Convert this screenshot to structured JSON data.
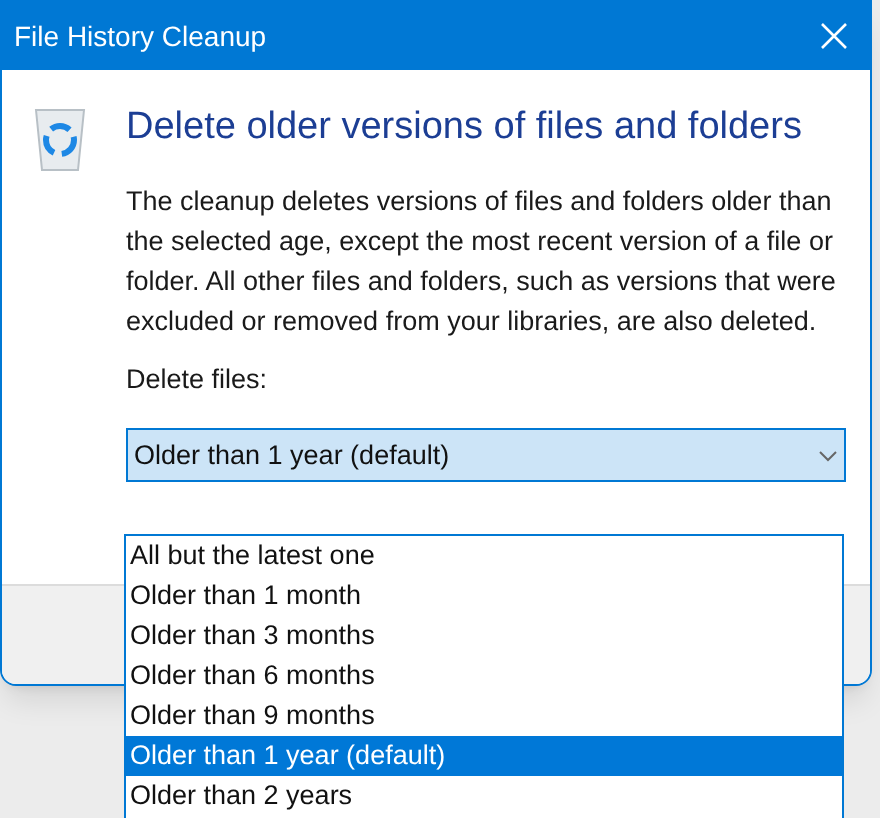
{
  "window": {
    "title": "File History Cleanup"
  },
  "heading": "Delete older versions of files and folders",
  "description": "The cleanup deletes versions of files and folders older than the selected age, except the most recent version of a file or folder. All other files and folders, such as versions that were excluded or removed from your libraries, are also deleted.",
  "delete_files": {
    "label": "Delete files:",
    "value": "Older than 1 year (default)",
    "expanded": true,
    "options": [
      {
        "label": "All but the latest one",
        "selected": false
      },
      {
        "label": "Older than 1 month",
        "selected": false
      },
      {
        "label": "Older than 3 months",
        "selected": false
      },
      {
        "label": "Older than 6 months",
        "selected": false
      },
      {
        "label": "Older than 9 months",
        "selected": false
      },
      {
        "label": "Older than 1 year (default)",
        "selected": true
      },
      {
        "label": "Older than 2 years",
        "selected": false
      }
    ]
  }
}
